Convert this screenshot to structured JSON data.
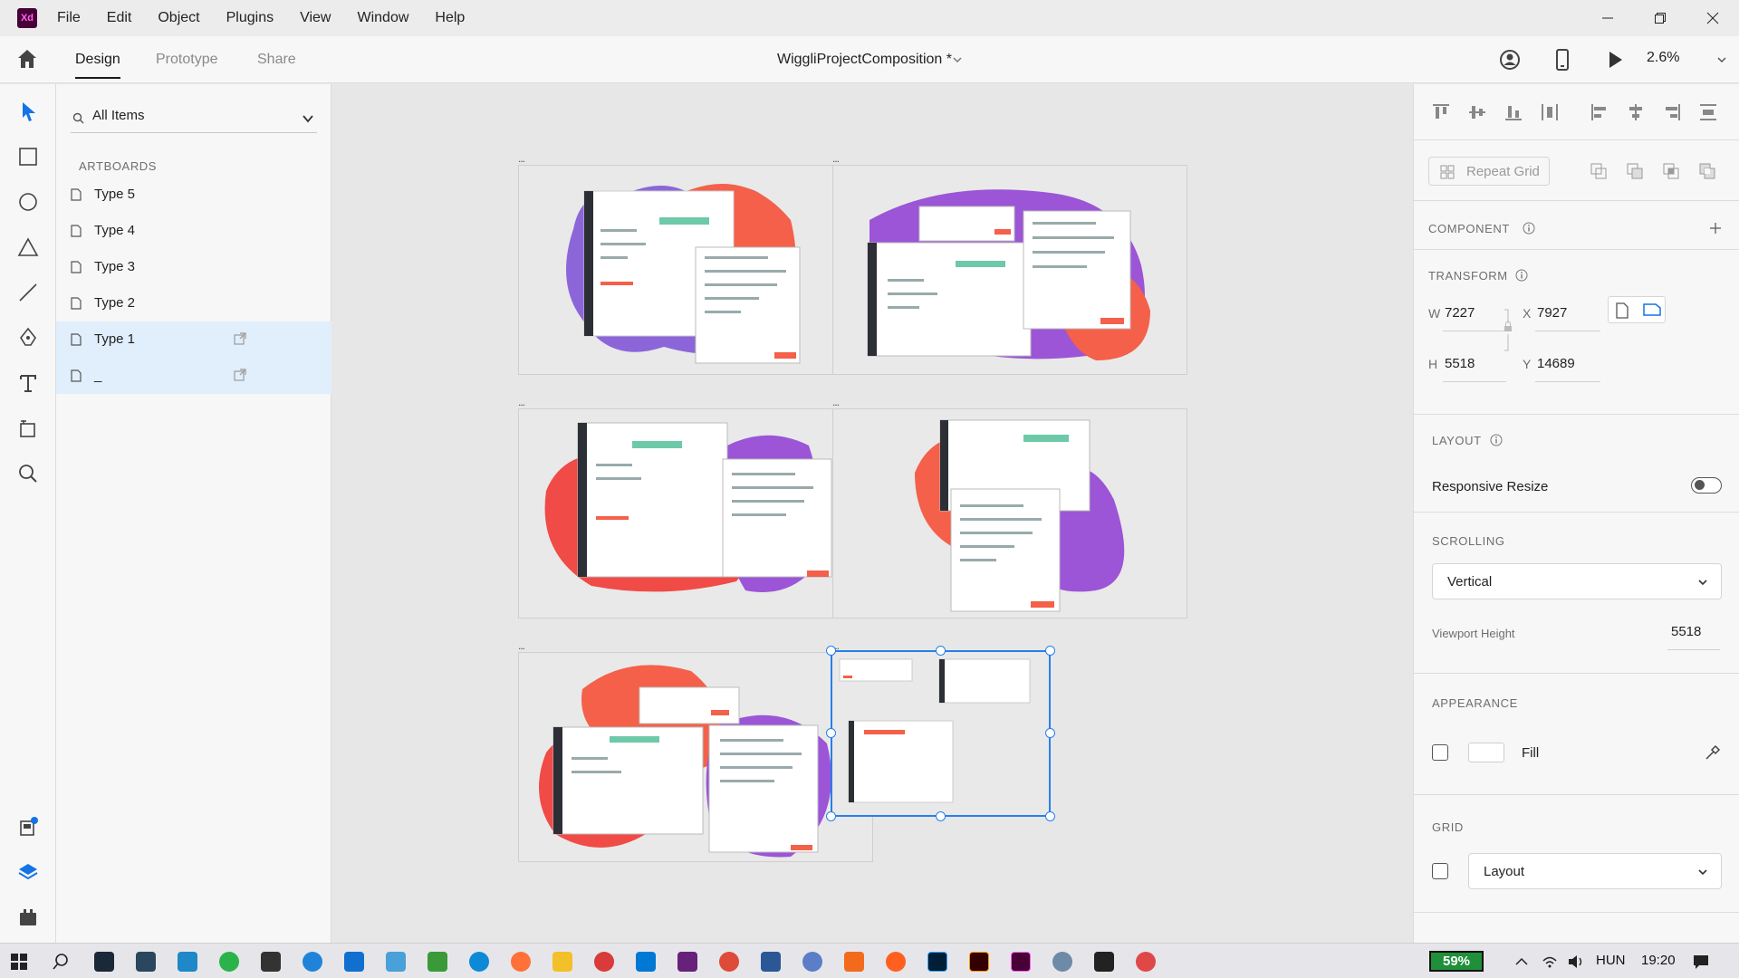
{
  "app": {
    "logo": "Xd",
    "accent": "#2680eb",
    "logo_bg": "#470137"
  },
  "menu": [
    "File",
    "Edit",
    "Object",
    "Plugins",
    "View",
    "Window",
    "Help"
  ],
  "window_controls": [
    "minimize-icon",
    "restore-icon",
    "close-icon"
  ],
  "modes": {
    "design": "Design",
    "prototype": "Prototype",
    "share": "Share"
  },
  "document": {
    "title": "WiggliProjectComposition *"
  },
  "zoom": "2.6%",
  "tools": [
    "select-arrow-icon",
    "rectangle-icon",
    "ellipse-icon",
    "triangle-icon",
    "line-icon",
    "pen-icon",
    "text-icon",
    "artboard-icon",
    "zoom-icon"
  ],
  "bottom_tools": [
    "assets-icon",
    "layers-icon",
    "plugins-icon"
  ],
  "layers": {
    "filter_label": "All Items",
    "section": "ARTBOARDS",
    "items": [
      {
        "label": "Type 5"
      },
      {
        "label": "Type 4"
      },
      {
        "label": "Type 3"
      },
      {
        "label": "Type 2"
      },
      {
        "label": "Type 1"
      },
      {
        "label": "_"
      }
    ]
  },
  "canvas": {
    "artboard_marker": "...",
    "artboards": [
      "Type 5",
      "Type 4",
      "Type 3",
      "Type 2",
      "Type 1",
      "_"
    ]
  },
  "props": {
    "repeat_grid": "Repeat Grid",
    "component": "COMPONENT",
    "transform": "TRANSFORM",
    "w_label": "W",
    "w": "7227",
    "x_label": "X",
    "x": "7927",
    "h_label": "H",
    "h": "5518",
    "y_label": "Y",
    "y": "14689",
    "layout": "LAYOUT",
    "responsive_resize": "Responsive Resize",
    "scrolling": "SCROLLING",
    "scrolling_value": "Vertical",
    "viewport_height_label": "Viewport Height",
    "viewport_height": "5518",
    "appearance": "APPEARANCE",
    "fill_label": "Fill",
    "grid": "GRID",
    "grid_value": "Layout"
  },
  "taskbar": {
    "battery": "59%",
    "language": "HUN",
    "time": "19:20"
  }
}
